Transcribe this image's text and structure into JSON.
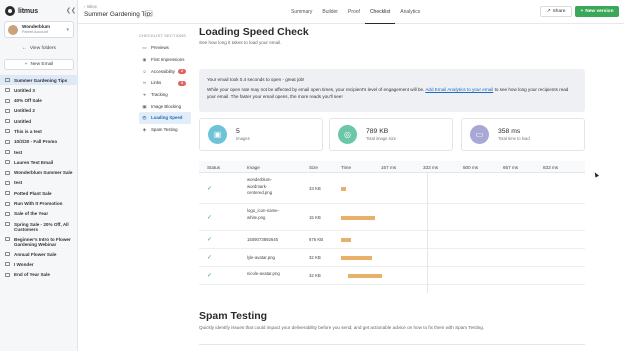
{
  "sidebar": {
    "logo": "litmus",
    "account_name": "Wonderblum",
    "account_sub": "Parent Account",
    "view_folders": "View folders",
    "new_email": "New Email",
    "emails": [
      "Summer Gardening Tips",
      "Untitled 3",
      "40% Off Sale",
      "Untitled 2",
      "Untitled",
      "This is a test",
      "10/2/20 - Fall Promo",
      "test",
      "Lauren Test Email",
      "Wonderblum Summer Sale",
      "test",
      "Potted Plant Sale",
      "Run With It Promotion",
      "Sale of the Year",
      "Spring Sale - 20% Off, All Customers",
      "Beginner's Intro to Flower Gardening Webinar",
      "Annual Flower Sale",
      "I Wonder",
      "End of Year Sale"
    ]
  },
  "topbar": {
    "crumb_small": "Inbox",
    "title": "Summer Gardening Tips",
    "more": "...",
    "tabs": [
      "Summary",
      "Builder",
      "Proof",
      "Checklist",
      "Analytics"
    ],
    "active_tab": "Checklist",
    "share": "Share",
    "new_version": "New version"
  },
  "checklist": {
    "heading": "CHECKLIST SECTIONS",
    "items": [
      {
        "label": "Previews",
        "icon": "monitor-icon",
        "badge": ""
      },
      {
        "label": "First Impressions",
        "icon": "eye-icon",
        "badge": ""
      },
      {
        "label": "Accessibility",
        "icon": "accessibility-icon",
        "badge": "2"
      },
      {
        "label": "Links",
        "icon": "link-icon",
        "badge": "3"
      },
      {
        "label": "Tracking",
        "icon": "tracking-icon",
        "badge": ""
      },
      {
        "label": "Image Blocking",
        "icon": "image-icon",
        "badge": ""
      },
      {
        "label": "Loading Speed",
        "icon": "speed-icon",
        "badge": ""
      },
      {
        "label": "Spam Testing",
        "icon": "shield-icon",
        "badge": ""
      }
    ],
    "active": "Loading Speed"
  },
  "main": {
    "title": "Loading Speed Check",
    "subtitle": "See how long it takes to load your email.",
    "notice_line1": "Your email took 0.4 seconds to open - great job!",
    "notice_line2_a": "While your open rate may not be affected by email open times, your recipient's level of engagement will be.",
    "notice_link": "Add Email Analytics to your email",
    "notice_line2_b": "to see how long your recipients read your email. The faster your email opens, the more reads you'll see!",
    "stats": [
      {
        "value": "5",
        "label": "Images",
        "color": "#6fc3d8"
      },
      {
        "value": "789 KB",
        "label": "Total image size",
        "color": "#6cc7a9"
      },
      {
        "value": "358 ms",
        "label": "Total time to load",
        "color": "#a7a8d6"
      }
    ]
  },
  "table": {
    "headers": [
      "Status",
      "Image",
      "Size",
      "Time",
      "167 ms",
      "333 ms",
      "500 ms",
      "667 ms",
      "833 ms"
    ],
    "rows": [
      {
        "image": "wonderblum-wordmark-centered.png",
        "size": "33 KB",
        "start": 0,
        "duration": 19
      },
      {
        "image": "logo_icon-name-white.png",
        "size": "15 KB",
        "start": 0,
        "duration": 125
      },
      {
        "image": "1509073892645",
        "size": "676 KB",
        "start": 0,
        "duration": 38
      },
      {
        "image": "lyle-avatar.png",
        "size": "32 KB",
        "start": 0,
        "duration": 116
      },
      {
        "image": "nicole-avatar.png",
        "size": "32 KB",
        "start": 25,
        "duration": 126
      }
    ],
    "scale_ms": 900
  },
  "spam": {
    "title": "Spam Testing",
    "subtitle": "Quickly identify issues that could impact your deliverability before you send; and get actionable advice on how to fix them with Spam Testing."
  }
}
